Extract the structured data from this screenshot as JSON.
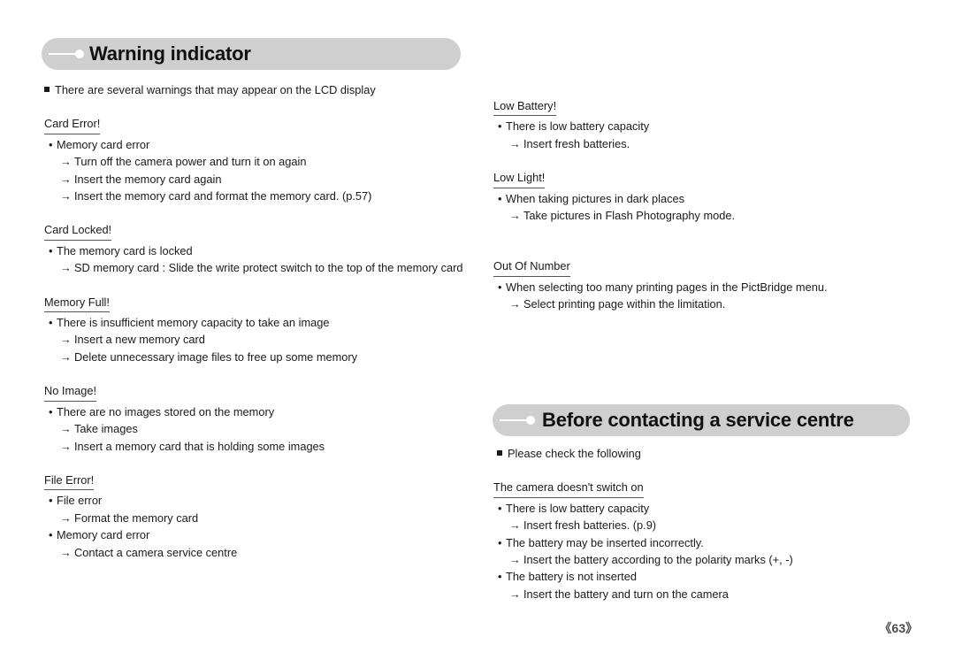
{
  "page": {
    "number": "《63》"
  },
  "headers": {
    "warning": "Warning indicator",
    "service": "Before contacting a service centre"
  },
  "left_column": {
    "intro_note": "There are several warnings that may appear on the LCD display",
    "sections": [
      {
        "heading": "Card Error!",
        "lines": [
          {
            "type": "bullet",
            "text": "Memory card error"
          },
          {
            "type": "arrow",
            "text": "Turn off the camera power and turn it on again"
          },
          {
            "type": "arrow",
            "text": "Insert the memory card again"
          },
          {
            "type": "arrow",
            "text": "Insert the memory card and format the memory card. (p.57)"
          }
        ]
      },
      {
        "heading": "Card Locked!",
        "lines": [
          {
            "type": "bullet",
            "text": "The memory card is locked"
          },
          {
            "type": "arrow",
            "text": "SD memory card : Slide the write protect switch to the top of the memory card"
          }
        ]
      },
      {
        "heading": "Memory Full!",
        "lines": [
          {
            "type": "bullet",
            "text": "There is insufficient memory capacity to take an image"
          },
          {
            "type": "arrow",
            "text": "Insert a new memory card"
          },
          {
            "type": "arrow",
            "text": "Delete unnecessary image files to free up some memory"
          }
        ]
      },
      {
        "heading": "No Image!",
        "lines": [
          {
            "type": "bullet",
            "text": "There are no images stored on the memory"
          },
          {
            "type": "arrow",
            "text": "Take images"
          },
          {
            "type": "arrow",
            "text": "Insert a memory card that is holding some images"
          }
        ]
      },
      {
        "heading": "File Error!",
        "lines": [
          {
            "type": "bullet",
            "text": "File error"
          },
          {
            "type": "arrow",
            "text": "Format the memory card"
          },
          {
            "type": "bullet",
            "text": "Memory card error"
          },
          {
            "type": "arrow",
            "text": "Contact a camera service centre"
          }
        ]
      }
    ]
  },
  "right_column": {
    "sections": [
      {
        "heading": "Low Battery!",
        "lines": [
          {
            "type": "bullet",
            "text": "There is low battery capacity"
          },
          {
            "type": "arrow",
            "text": "Insert fresh batteries."
          }
        ]
      },
      {
        "heading": "Low Light!",
        "lines": [
          {
            "type": "bullet",
            "text": "When taking pictures in dark places"
          },
          {
            "type": "arrow",
            "text": "Take pictures in Flash Photography mode."
          }
        ]
      },
      {
        "heading": "Out Of Number",
        "lines": [
          {
            "type": "bullet",
            "text": "When selecting too many printing pages in the PictBridge menu."
          },
          {
            "type": "arrow",
            "text": "Select printing page within the limitation."
          }
        ]
      }
    ]
  },
  "right_column_lower": {
    "intro_note": "Please check the following",
    "sections": [
      {
        "heading": "The camera doesn't switch on",
        "lines": [
          {
            "type": "bullet",
            "text": "There is low battery capacity"
          },
          {
            "type": "arrow",
            "text": "Insert fresh batteries. (p.9)"
          },
          {
            "type": "bullet",
            "text": "The battery may be inserted incorrectly."
          },
          {
            "type": "arrow",
            "text": "Insert the battery according to the polarity marks (+, -)"
          },
          {
            "type": "bullet",
            "text": "The battery is not inserted"
          },
          {
            "type": "arrow",
            "text": "Insert the battery and turn on the camera"
          }
        ]
      }
    ]
  },
  "glyphs": {
    "bullet_dot": "•",
    "arrow": "→"
  }
}
